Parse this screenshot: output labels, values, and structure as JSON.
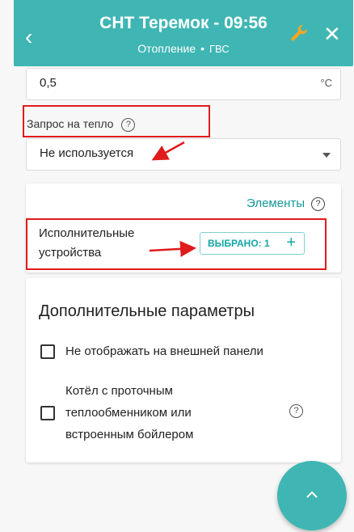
{
  "header": {
    "title": "СНТ Теремок - 09:56",
    "subtitle_left": "Отопление",
    "subtitle_sep": "•",
    "subtitle_right": "ГВС",
    "back_icon": "chevron-left-icon",
    "settings_icon": "wrench-icon",
    "close_icon": "close-icon",
    "accent_color": "#3fb6b4",
    "wrench_color": "#f5a623"
  },
  "hysteresis": {
    "value": "0,5",
    "unit": "°C"
  },
  "heat_request": {
    "label": "Запрос на тепло",
    "help": "?",
    "selected": "Не используется"
  },
  "elements_card": {
    "link_label": "Элементы",
    "help": "?",
    "actuators_label_line1": "Исполнительные",
    "actuators_label_line2": "устройства",
    "chip_label": "ВЫБРАНО: 1",
    "chip_plus": "+"
  },
  "extra_params": {
    "title": "Дополнительные параметры",
    "option1": "Не отображать на внешней панели",
    "option2_line1": "Котёл с проточным",
    "option2_line2": "теплообменником или",
    "option2_line3": "встроенным бойлером",
    "option2_help": "?"
  },
  "annotation_color": "#e01b1b"
}
